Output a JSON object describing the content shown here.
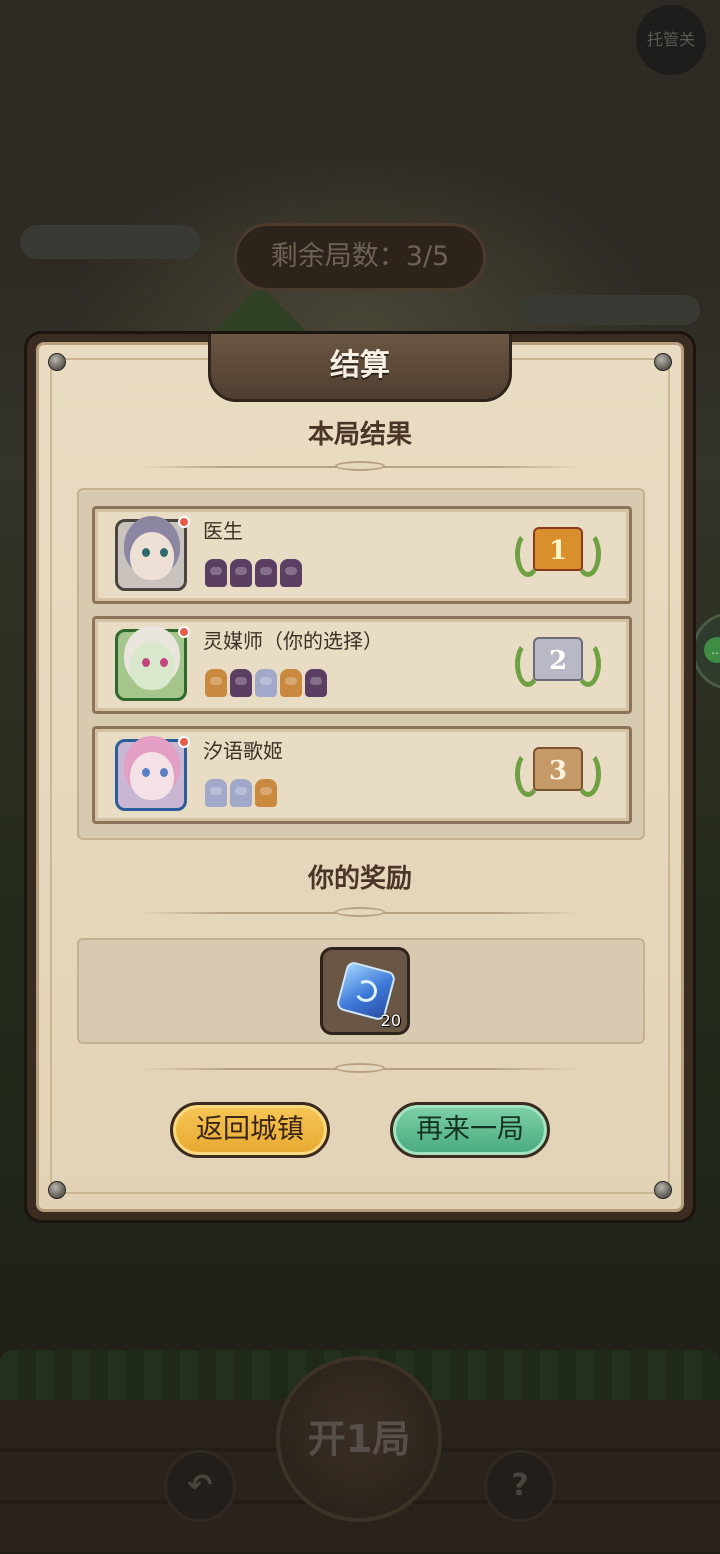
{
  "top_bar": {
    "auto_button_label": "托管关"
  },
  "rounds": {
    "label": "剩余局数：3/5"
  },
  "dialog": {
    "title": "结算",
    "results_heading": "本局结果",
    "rewards_heading": "你的奖励",
    "results": [
      {
        "name": "医生",
        "rank": "1",
        "avatar_color": "#c9c2bd",
        "frame_color": "#8c8580",
        "unit_colors": [
          "#5b3f63",
          "#5b3f63",
          "#5b3f63",
          "#5b3f63"
        ],
        "crown_color": "#d9902c"
      },
      {
        "name": "灵媒师（你的选择）",
        "rank": "2",
        "avatar_color": "#a4c58c",
        "frame_color": "#3f8a3c",
        "unit_colors": [
          "#c98a3f",
          "#5b3f63",
          "#a2a8c9",
          "#c98a3f",
          "#5b3f63"
        ],
        "crown_color": "#a8a8b6"
      },
      {
        "name": "汐语歌姬",
        "rank": "3",
        "avatar_color": "#c9b6d3",
        "frame_color": "#3f7cc0",
        "unit_colors": [
          "#a2a8c9",
          "#a2a8c9",
          "#c98a3f"
        ],
        "crown_color": "#b38a5a"
      }
    ],
    "reward": {
      "item": "blue-gem",
      "count": "20"
    },
    "buttons": {
      "return_label": "返回城镇",
      "again_label": "再来一局"
    }
  },
  "bottom": {
    "start_label": "开1局",
    "undo_icon": "↶",
    "help_icon": "?"
  },
  "side_tab": {
    "icon_label": "…"
  },
  "colors": {
    "panel_bg": "#e9dcc2",
    "return_button": "#f2ba45",
    "again_button": "#5fbf93"
  }
}
